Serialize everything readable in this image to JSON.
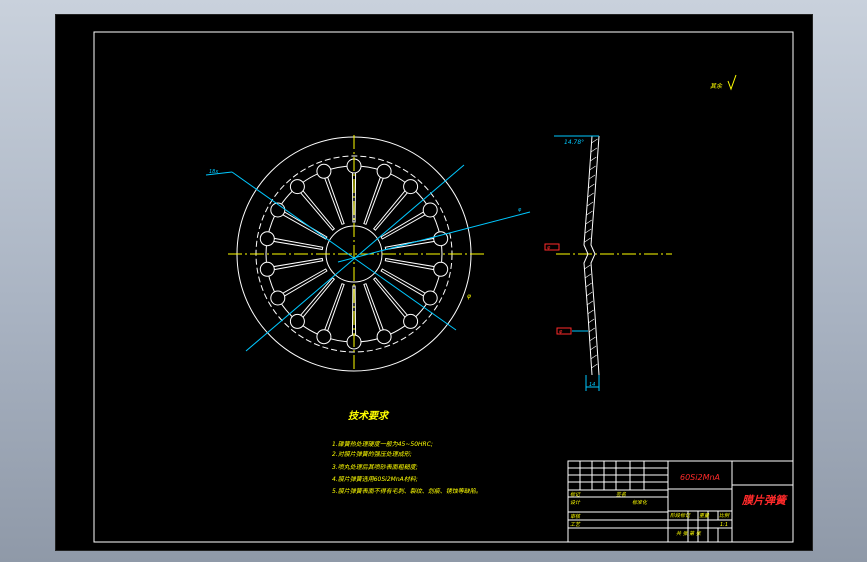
{
  "drawing": {
    "tech_title": "技术要求",
    "requirements": [
      "1.碟簧热处理硬度一般为45~50HRC;",
      "2.对膜片弹簧的强压处理成形;",
      "3.喷丸处理后其喷砂表面粗糙度;",
      "4.膜片弹簧选用60Si2MnA材料;",
      "5.膜片弹簧表面不得有毛刺、裂纹、划痕、锈蚀等缺陷。"
    ],
    "roughness_note": "其余",
    "labels": {
      "left_dim": "18x",
      "right_dim": "φ",
      "angle_dim": "14.78°",
      "side_dim_top": "φ",
      "side_dim_bottom": "φ",
      "side_dim_thick": "14"
    }
  },
  "title_block": {
    "material": "60Si2MnA",
    "part_name": "膜片弹簧",
    "rows": [
      "标记",
      "处数",
      "分区",
      "更改文件号",
      "签名",
      "年月日"
    ],
    "design": "设计",
    "standard": "标准化",
    "review": "审核",
    "process": "工艺",
    "stage": "阶段标记",
    "weight": "重量",
    "scale_label": "比例",
    "scale": "1:1",
    "sheets": "共 张 第 张"
  },
  "colors": {
    "outline": "#ffffff",
    "circle": "#ffffff",
    "center_line": "#ffff00",
    "leader": "#00c8ff",
    "text": "#ffff00",
    "red_text": "#ff2a2a"
  }
}
